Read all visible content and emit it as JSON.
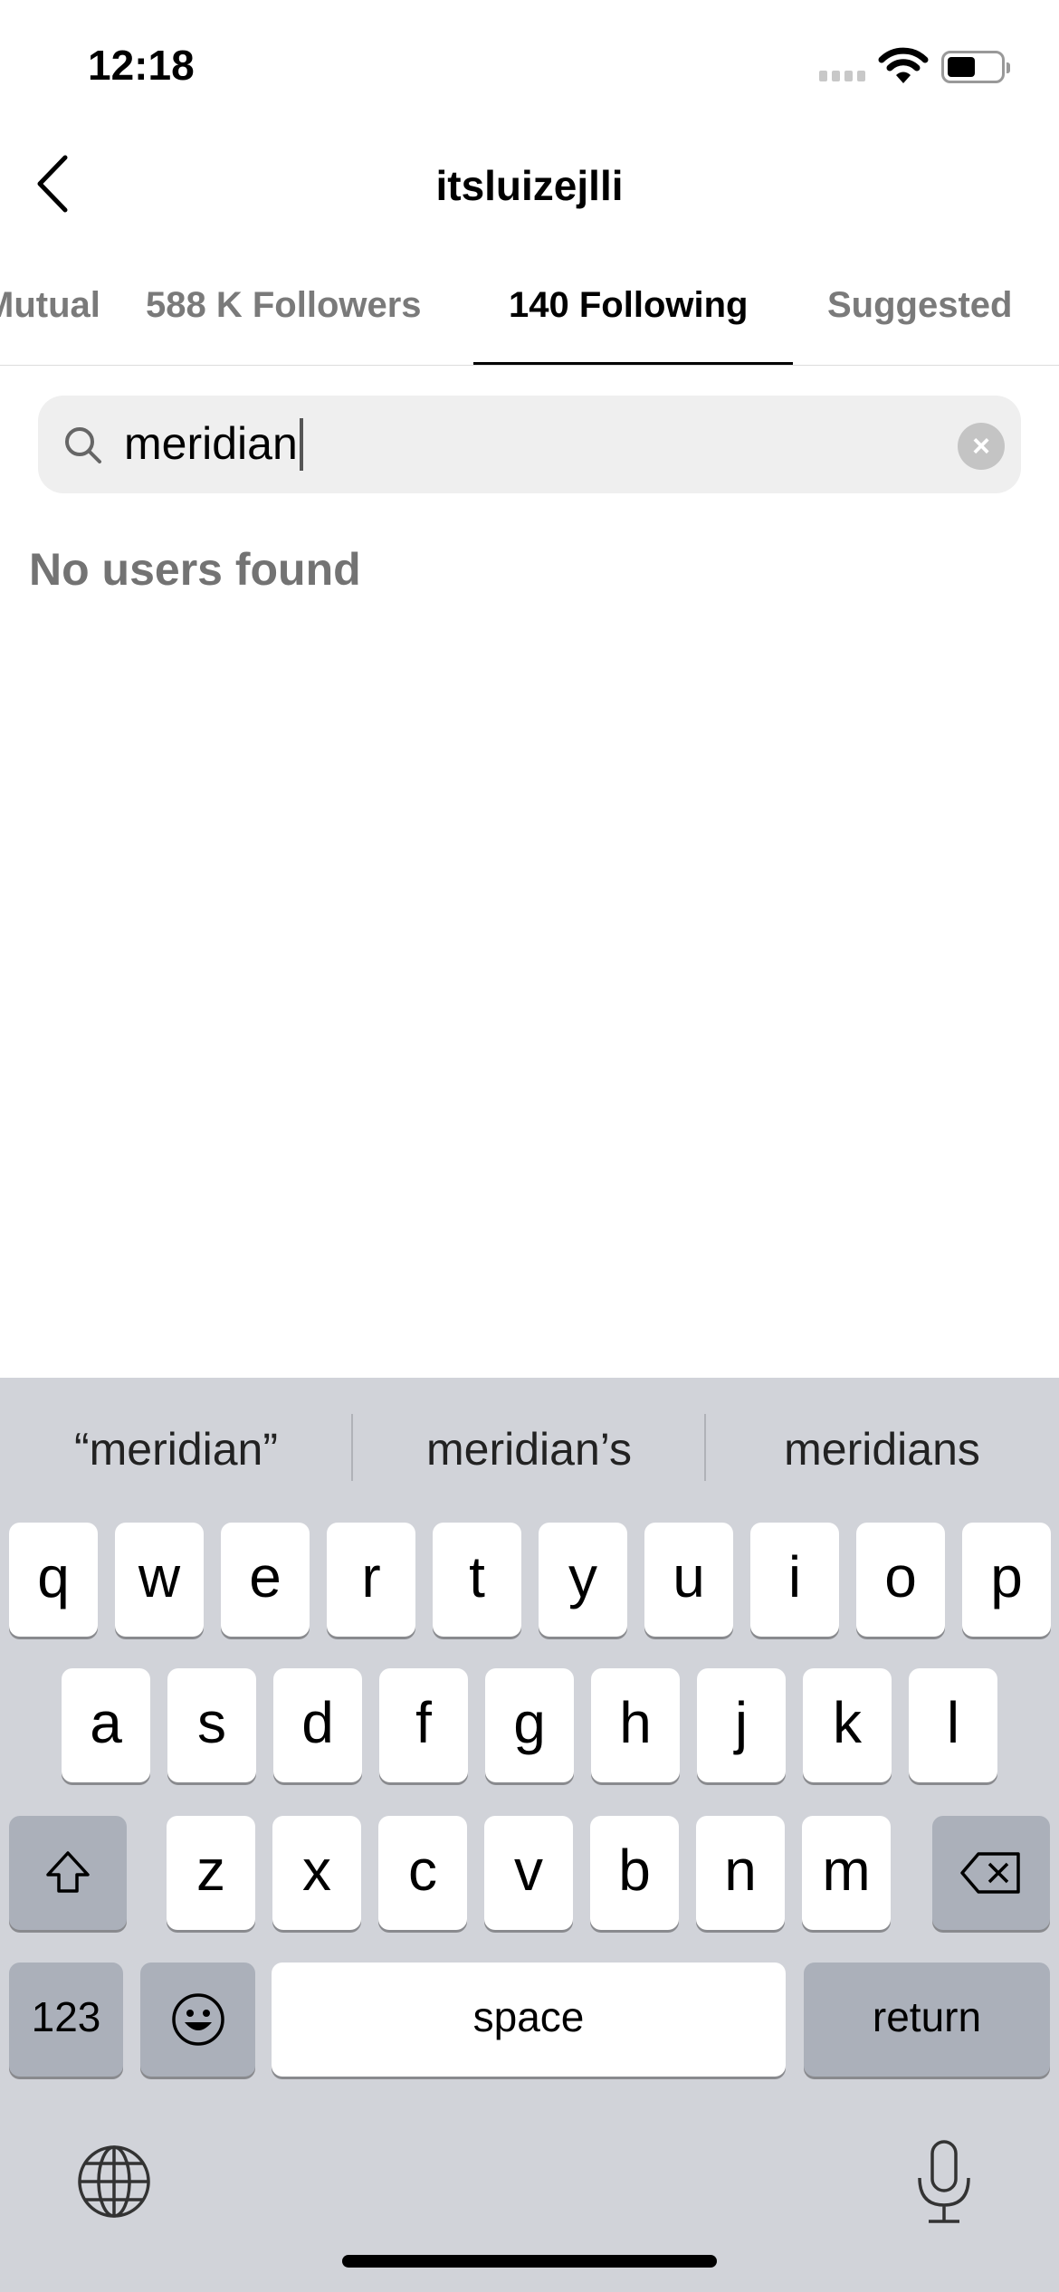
{
  "status_bar": {
    "time": "12:18",
    "battery_level": 0.5
  },
  "header": {
    "title": "itsluizejlli",
    "back_icon": "chevron-left-icon"
  },
  "tabs": [
    {
      "label": "Mutual"
    },
    {
      "label": "588 K Followers"
    },
    {
      "label": "140 Following",
      "active": true
    },
    {
      "label": "Suggested"
    }
  ],
  "search": {
    "value": "meridian",
    "clear_icon": "clear-circle-icon"
  },
  "results": {
    "empty_message": "No users found"
  },
  "keyboard": {
    "suggestions": [
      "“meridian”",
      "meridian’s",
      "meridians"
    ],
    "row1": [
      "q",
      "w",
      "e",
      "r",
      "t",
      "y",
      "u",
      "i",
      "o",
      "p"
    ],
    "row2": [
      "a",
      "s",
      "d",
      "f",
      "g",
      "h",
      "j",
      "k",
      "l"
    ],
    "row3": [
      "z",
      "x",
      "c",
      "v",
      "b",
      "n",
      "m"
    ],
    "numbers_label": "123",
    "space_label": "space",
    "return_label": "return"
  }
}
